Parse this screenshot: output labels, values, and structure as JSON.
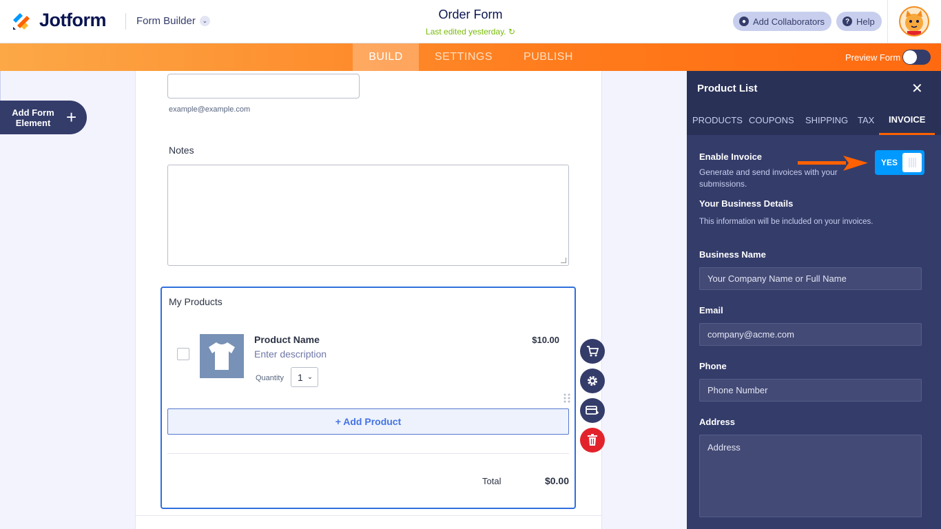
{
  "header": {
    "brand": "Jotform",
    "builder_label": "Form Builder",
    "form_title": "Order Form",
    "last_edited": "Last edited yesterday.",
    "add_collaborators": "Add Collaborators",
    "help": "Help"
  },
  "nav": {
    "tabs": [
      "BUILD",
      "SETTINGS",
      "PUBLISH"
    ],
    "active_tab": "BUILD",
    "preview_label": "Preview Form"
  },
  "left": {
    "add_element_label": "Add Form Element"
  },
  "form": {
    "email_sublabel": "example@example.com",
    "notes_label": "Notes",
    "products_title": "My Products",
    "product": {
      "name": "Product Name",
      "description": "Enter description",
      "price": "$10.00",
      "quantity_label": "Quantity",
      "quantity_value": "1"
    },
    "add_product": "+ Add Product",
    "total_label": "Total",
    "total_value": "$0.00"
  },
  "panel": {
    "title": "Product List",
    "tabs": [
      "PRODUCTS",
      "COUPONS",
      "SHIPPING",
      "TAX",
      "INVOICE"
    ],
    "active_tab": "INVOICE",
    "enable_invoice_label": "Enable Invoice",
    "enable_invoice_help": "Generate and send invoices with your submissions.",
    "toggle_value": "YES",
    "business_details_label": "Your Business Details",
    "business_details_help": "This information will be included on your invoices.",
    "business_name_label": "Business Name",
    "business_name_placeholder": "Your Company Name or Full Name",
    "email_label": "Email",
    "email_placeholder": "company@acme.com",
    "phone_label": "Phone",
    "phone_placeholder": "Phone Number",
    "address_label": "Address",
    "address_placeholder": "Address"
  },
  "colors": {
    "brand_orange": "#ff6100",
    "navy": "#343c6a",
    "selection_blue": "#2e6fdc",
    "toggle_blue": "#0099ff",
    "delete_red": "#e3232c",
    "edited_green": "#78bb07"
  },
  "icons": [
    "jotform-logo-icon",
    "chevron-down-icon",
    "refresh-icon",
    "user-icon",
    "question-icon",
    "avatar-icon",
    "plus-icon",
    "tshirt-icon",
    "drag-handle-icon",
    "cart-icon",
    "gear-icon",
    "payment-card-icon",
    "trash-icon",
    "close-icon",
    "arrow-right-icon"
  ]
}
